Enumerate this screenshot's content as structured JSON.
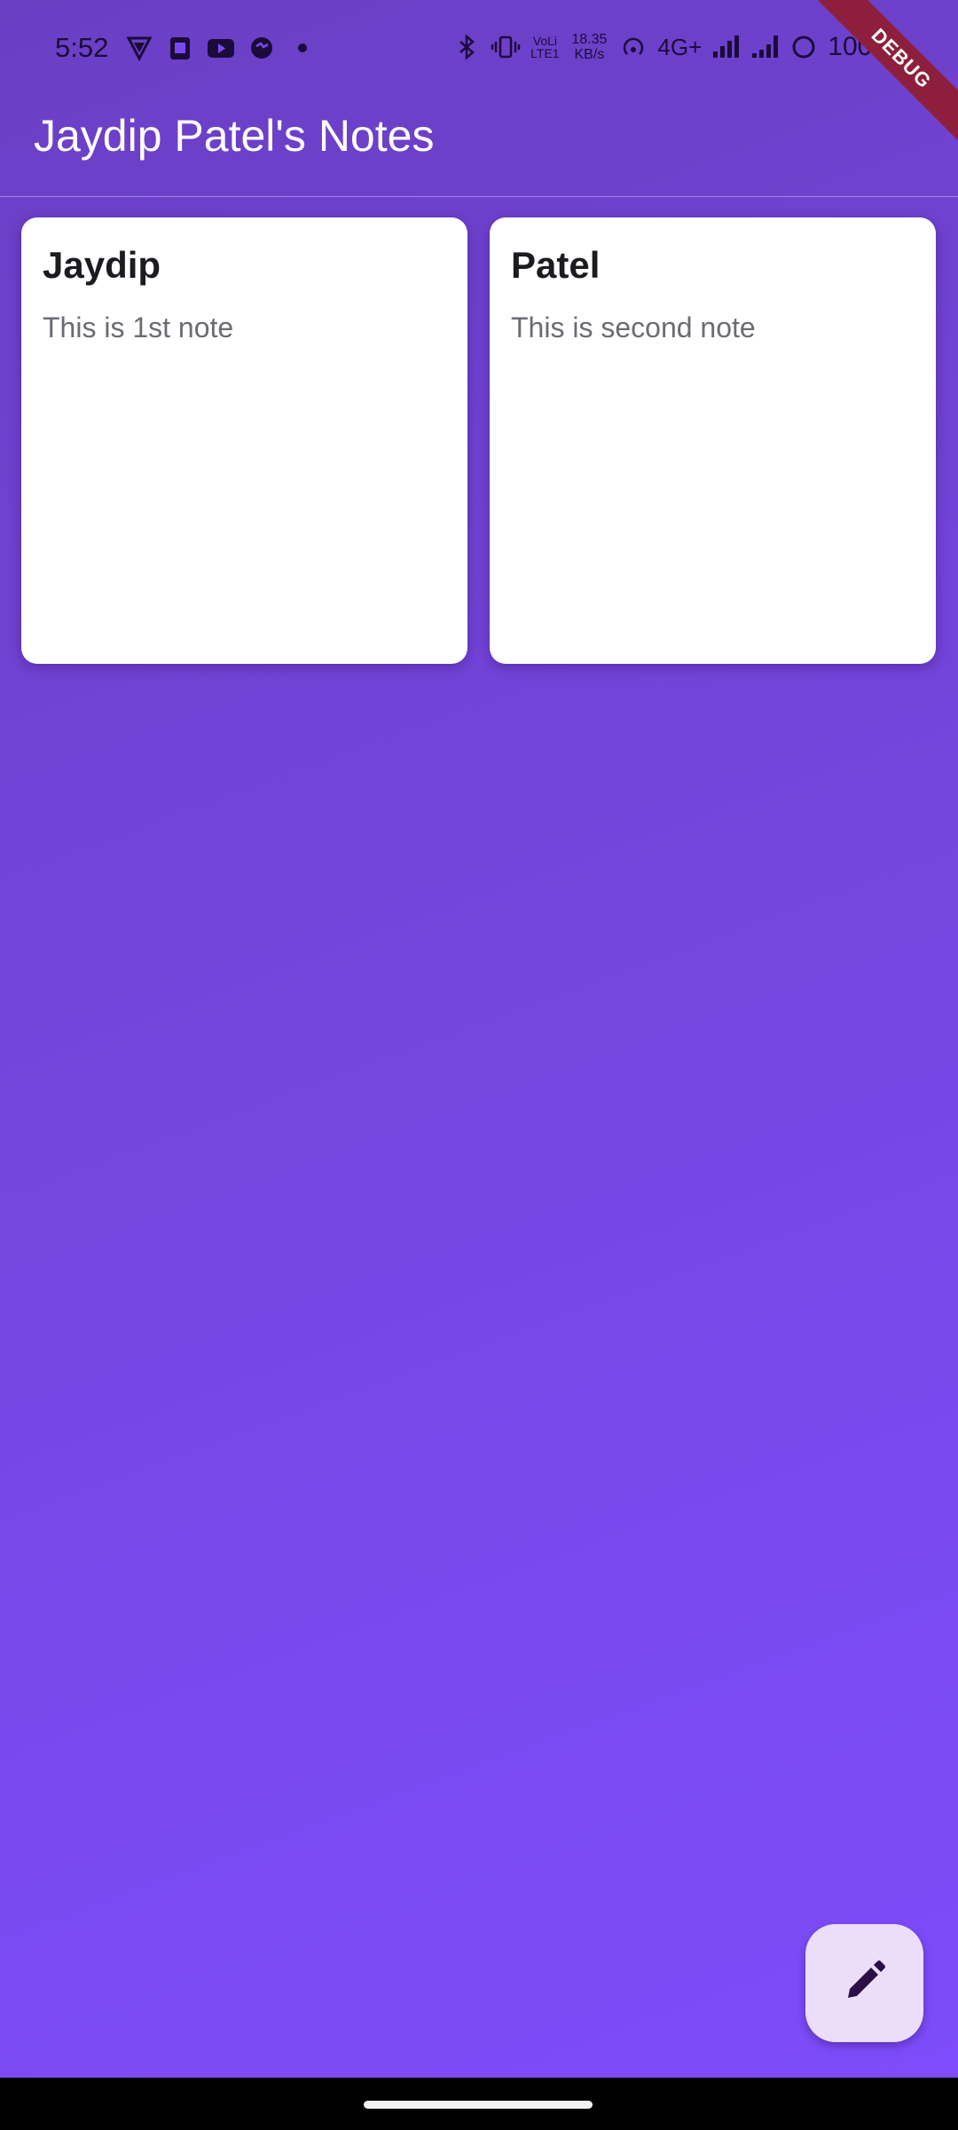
{
  "status_bar": {
    "time": "5:52",
    "net_speed_value": "18.35",
    "net_speed_unit": "KB/s",
    "volte_top": "VoLi",
    "volte_bottom": "LTE1",
    "network_type": "4G+",
    "battery": "100%"
  },
  "debug_banner": "DEBUG",
  "app_bar": {
    "title": "Jaydip Patel's Notes"
  },
  "notes": [
    {
      "title": "Jaydip",
      "body": "This is 1st note"
    },
    {
      "title": "Patel",
      "body": "This is second note"
    }
  ],
  "fab": {
    "icon": "edit-pencil-icon"
  },
  "colors": {
    "background_start": "#6a3fc4",
    "background_end": "#7e4cfb",
    "card": "#ffffff",
    "fab": "#ecddfb",
    "debug_ribbon": "#8e1f3c"
  }
}
